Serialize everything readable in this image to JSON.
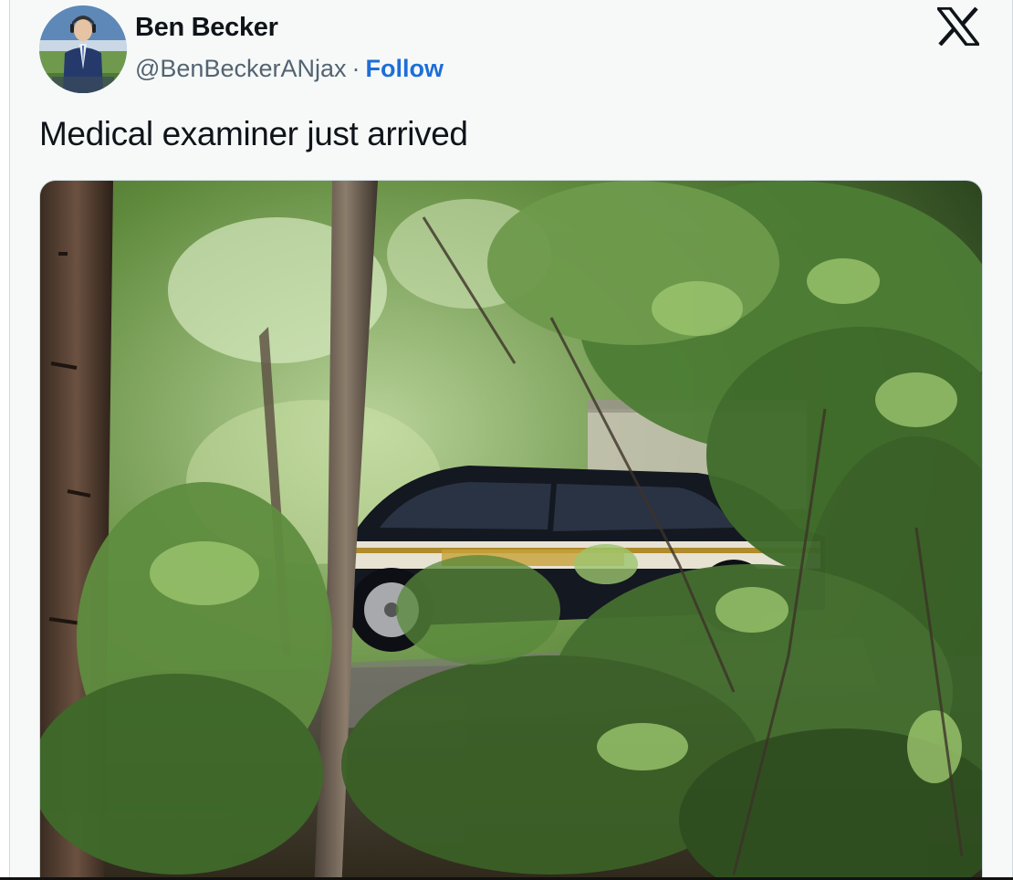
{
  "tweet": {
    "author_name": "Ben Becker",
    "handle": "@BenBeckerANjax",
    "separator": "·",
    "follow_label": "Follow",
    "text": "Medical examiner just arrived"
  },
  "icons": {
    "brand": "x-logo-icon"
  },
  "colors": {
    "follow_link": "#1d6fd8",
    "card_background": "#f7f9f9",
    "text_primary": "#0f1419",
    "text_secondary": "#536471"
  }
}
